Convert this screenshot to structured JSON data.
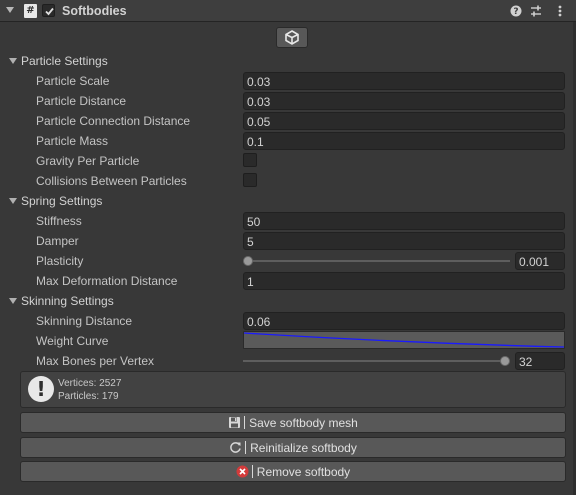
{
  "component": {
    "title": "Softbodies",
    "script_icon": "#",
    "enabled": true
  },
  "sections": {
    "particle": {
      "title": "Particle Settings",
      "particle_scale": {
        "label": "Particle Scale",
        "value": "0.03"
      },
      "particle_distance": {
        "label": "Particle Distance",
        "value": "0.03"
      },
      "particle_connection_distance": {
        "label": "Particle Connection Distance",
        "value": "0.05"
      },
      "particle_mass": {
        "label": "Particle Mass",
        "value": "0.1"
      },
      "gravity_per_particle": {
        "label": "Gravity Per Particle",
        "checked": false
      },
      "collisions_between_particles": {
        "label": "Collisions Between Particles",
        "checked": false
      }
    },
    "spring": {
      "title": "Spring Settings",
      "stiffness": {
        "label": "Stiffness",
        "value": "50"
      },
      "damper": {
        "label": "Damper",
        "value": "5"
      },
      "plasticity": {
        "label": "Plasticity",
        "value": "0.001",
        "fraction": 0.0
      },
      "max_deformation_distance": {
        "label": "Max Deformation Distance",
        "value": "1"
      }
    },
    "skinning": {
      "title": "Skinning Settings",
      "skinning_distance": {
        "label": "Skinning Distance",
        "value": "0.06"
      },
      "weight_curve": {
        "label": "Weight Curve",
        "curve_color": "#1a1aff"
      },
      "max_bones_per_vertex": {
        "label": "Max Bones per Vertex",
        "value": "32",
        "fraction": 1.0
      }
    }
  },
  "info": {
    "vertices": "Vertices: 2527",
    "particles": "Particles: 179"
  },
  "buttons": {
    "save": "Save softbody mesh",
    "reinitialize": "Reinitialize softbody",
    "remove": "Remove softbody"
  },
  "icons": {
    "help": "help-icon",
    "presets": "presets-icon",
    "menu": "kebab-menu-icon",
    "unity": "unity-logo-icon",
    "save": "floppy-disk-icon",
    "refresh": "refresh-icon",
    "remove": "red-x-icon"
  },
  "colors": {
    "remove_icon": "#d23b3b",
    "background": "#383838"
  }
}
